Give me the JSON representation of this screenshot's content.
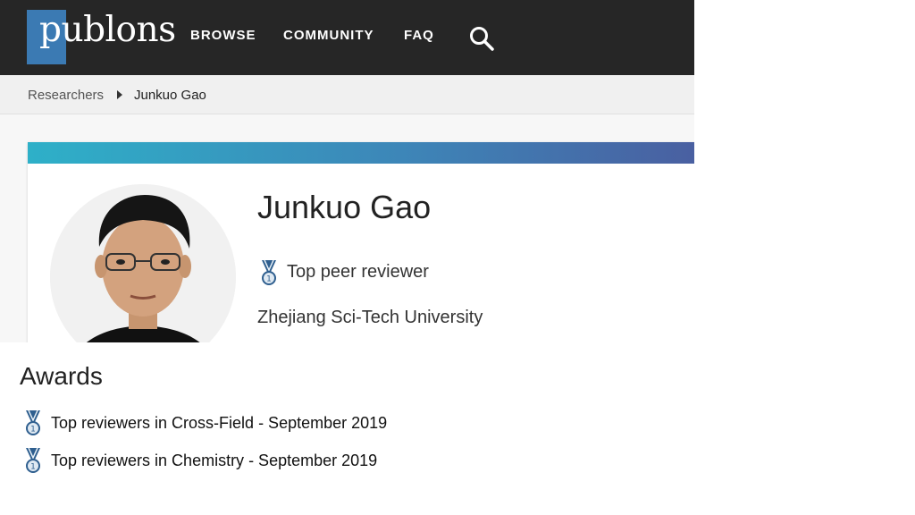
{
  "brand": {
    "logo_text": "publons"
  },
  "nav": {
    "browse": "BROWSE",
    "community": "COMMUNITY",
    "faq": "FAQ"
  },
  "breadcrumb": {
    "parent": "Researchers",
    "current": "Junkuo Gao"
  },
  "profile": {
    "name": "Junkuo Gao",
    "badge": "Top peer reviewer",
    "affiliation": "Zhejiang Sci-Tech University"
  },
  "awards": {
    "title": "Awards",
    "items": [
      {
        "label": "Top reviewers in Cross-Field - September 2019"
      },
      {
        "label": "Top reviewers in Chemistry - September 2019"
      }
    ]
  },
  "colors": {
    "navbar": "#262626",
    "logo_square": "#3b7ab3",
    "header_gradient_start": "#2eb0c8",
    "header_gradient_end": "#4a5ea0",
    "medal_ribbon": "#2f5f8f"
  },
  "icons": {
    "search": "search-icon",
    "medal": "medal-icon",
    "breadcrumb_sep": "chevron-right-icon"
  }
}
